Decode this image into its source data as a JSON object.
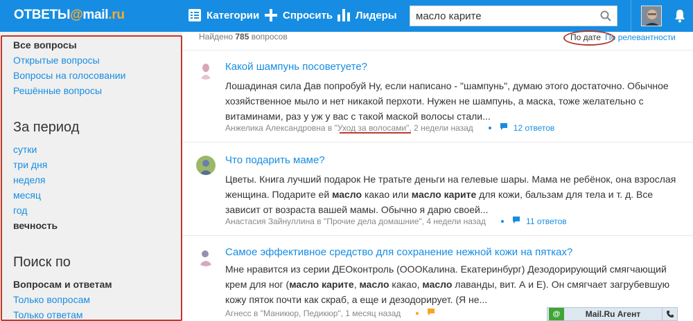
{
  "topbar": {
    "logo_part1": "ОТВЕТЫ",
    "logo_at": "@",
    "logo_part2": "mail",
    "logo_part3": ".ru",
    "nav": {
      "categories": "Категории",
      "ask": "Спросить",
      "leaders": "Лидеры"
    },
    "search_value": "масло карите",
    "icons": [
      "categories-icon",
      "plus-icon",
      "leaders-icon",
      "search-icon",
      "bell-icon"
    ]
  },
  "sidebar": {
    "filters": {
      "all": "Все вопросы",
      "open": "Открытые вопросы",
      "voting": "Вопросы на голосовании",
      "solved": "Решённые вопросы"
    },
    "period_heading": "За период",
    "period": [
      "сутки",
      "три дня",
      "неделя",
      "месяц",
      "год",
      "вечность"
    ],
    "search_heading": "Поиск по",
    "search_by": [
      "Вопросам и ответам",
      "Только вопросам",
      "Только ответам"
    ]
  },
  "results": {
    "found_prefix": "Найдено",
    "found_count": "785",
    "found_suffix": "вопросов",
    "sort_date": "По дате",
    "sort_relevance": "По релевантности"
  },
  "questions": [
    {
      "title": "Какой шампунь посоветуете?",
      "text_html": "Лошадиная сила Дав попробуй Ну, если написано - \"шампунь\", думаю этого достаточно. Обычное хозяйственное мыло и нет никакой перхоти. Нужен не шампунь, а маска, тоже желательно с витаминами, раз у уж у вас с такой маской волосы стали...",
      "author_prefix": "Анжелика Александровна в \"",
      "category": "Уход за волосами",
      "time": "\", 2 недели назад",
      "answers": "12 ответов",
      "dot_color": "#168de2"
    },
    {
      "title": "Что подарить маме?",
      "text_html": "Цветы. Книга лучший подарок Не тратьте деньги на гелевые шары. Мама не ребёнок, она взрослая женщина. Подарите ей <b>масло</b> какао или <b>масло карите</b> для кожи, бальзам для тела и т. д. Все зависит от возраста вашей мамы. Обычно я дарю своей...",
      "author_prefix": "Анастасия Зайнуллина в \"",
      "category": "Прочие дела домашние",
      "time": "\", 4 недели назад",
      "answers": "11 ответов",
      "dot_color": "#168de2"
    },
    {
      "title": "Самое эффективное средство для сохранение нежной кожи на пятках?",
      "text_html": "Мне нравится из серии ДЕОконтроль (ОООКалина. Екатеринбург) Дезодорирующий смягчающий крем для ног (<b>масло карите</b>, <b>масло</b> какао, <b>масло</b> лаванды, вит. А и Е). Он смягчает загрубевшую кожу пяток почти как скраб, а еще и дезодорирует. (Я не...",
      "author_prefix": "Агнесс в \"",
      "category": "Маникюр, Педикюр",
      "time": "\", 1 месяц назад",
      "answers": "",
      "dot_color": "#f5a623"
    }
  ],
  "agent": {
    "label": "Mail.Ru Агент",
    "at": "@"
  },
  "colors": {
    "brand_blue": "#168de2",
    "logo_orange": "#ffa930",
    "annotation_red": "#c0392b"
  }
}
